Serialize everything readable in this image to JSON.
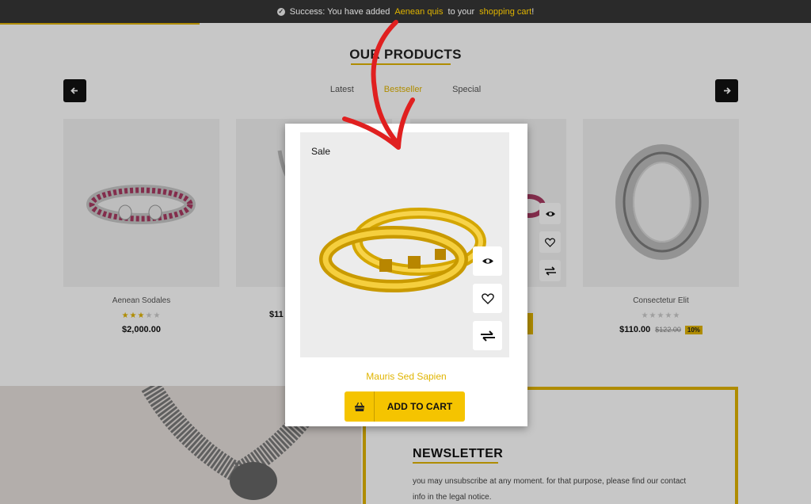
{
  "notification": {
    "prefix": "Success: You have added",
    "product_link": "Aenean quis",
    "middle": "to your",
    "cart_link": "shopping cart",
    "suffix": "!"
  },
  "section": {
    "title": "OUR PRODUCTS",
    "tabs": [
      {
        "label": "Latest",
        "active": false
      },
      {
        "label": "Bestseller",
        "active": true
      },
      {
        "label": "Special",
        "active": false
      }
    ],
    "prev_arrow": "◄",
    "next_arrow": "►"
  },
  "products": [
    {
      "name": "Aenean Sodales",
      "rating": 3,
      "price": "$2,000.00"
    },
    {
      "name": "",
      "rating": 0,
      "price": "$11"
    },
    {
      "name": "",
      "rating": 0,
      "price": ""
    },
    {
      "name": "Consectetur Elit",
      "rating": 0,
      "price": "$110.00",
      "old_price": "$122.00",
      "discount": "10%"
    }
  ],
  "popup": {
    "badge": "Sale",
    "product_name": "Mauris Sed Sapien",
    "add_to_cart": "ADD TO CART",
    "icons": [
      "eye-icon",
      "heart-icon",
      "compare-icon"
    ]
  },
  "newsletter": {
    "title": "NEWSLETTER",
    "text": "you may unsubscribe at any moment. for that purpose, please find our contact info in the legal notice."
  },
  "colors": {
    "accent": "#e0b400",
    "button": "#f5c400",
    "topbar": "#2a2a2a"
  }
}
